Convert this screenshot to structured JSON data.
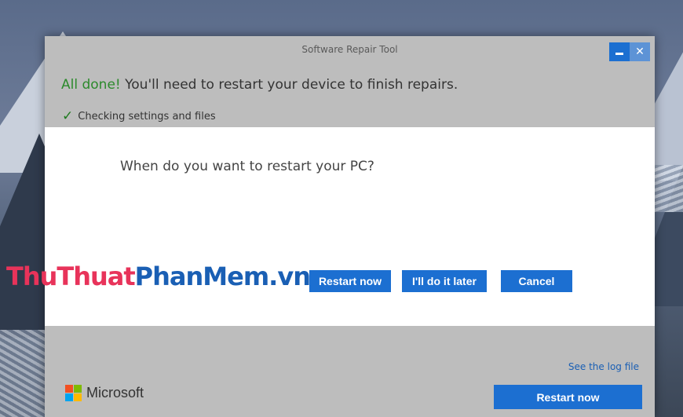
{
  "window": {
    "title": "Software Repair Tool",
    "minimize_icon": "minimize-icon",
    "close_icon": "close-icon",
    "close_glyph": "✕"
  },
  "status": {
    "done_label": "All done!",
    "message": "You'll need to restart your device to finish repairs.",
    "check_icon": "check-icon",
    "check_glyph": "✓",
    "check_label": "Checking settings and files"
  },
  "dialog": {
    "question": "When do you want to restart your PC?",
    "restart_now_label": "Restart now",
    "later_label": "I'll do it later",
    "cancel_label": "Cancel"
  },
  "watermark": {
    "part1": "ThuThuat",
    "part2": "PhanMem.vn"
  },
  "footer": {
    "log_link": "See the log file",
    "brand": "Microsoft",
    "restart_now_label": "Restart now"
  },
  "colors": {
    "accent": "#1c6fd1",
    "success": "#2c8a2c",
    "window_bg": "#bdbdbd",
    "panel_bg": "#ffffff"
  }
}
